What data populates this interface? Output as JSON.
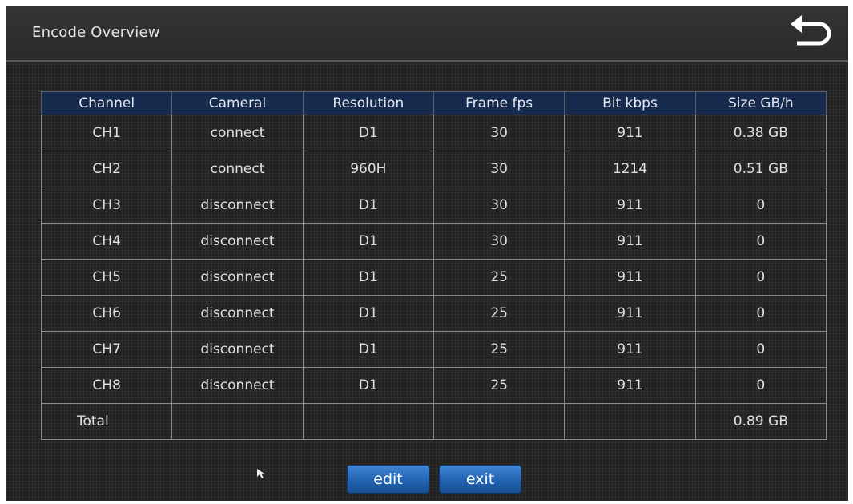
{
  "window": {
    "title": "Encode Overview"
  },
  "header": {
    "back_icon": "return-arrow-icon"
  },
  "table": {
    "columns": [
      "Channel",
      "Cameral",
      "Resolution",
      "Frame fps",
      "Bit kbps",
      "Size GB/h"
    ],
    "rows": [
      [
        "CH1",
        "connect",
        "D1",
        "30",
        "911",
        "0.38 GB"
      ],
      [
        "CH2",
        "connect",
        "960H",
        "30",
        "1214",
        "0.51 GB"
      ],
      [
        "CH3",
        "disconnect",
        "D1",
        "30",
        "911",
        "0"
      ],
      [
        "CH4",
        "disconnect",
        "D1",
        "30",
        "911",
        "0"
      ],
      [
        "CH5",
        "disconnect",
        "D1",
        "25",
        "911",
        "0"
      ],
      [
        "CH6",
        "disconnect",
        "D1",
        "25",
        "911",
        "0"
      ],
      [
        "CH7",
        "disconnect",
        "D1",
        "25",
        "911",
        "0"
      ],
      [
        "CH8",
        "disconnect",
        "D1",
        "25",
        "911",
        "0"
      ]
    ],
    "total": {
      "label": "Total",
      "size": "0.89 GB"
    }
  },
  "buttons": {
    "edit_label": "edit",
    "exit_label": "exit"
  },
  "colors": {
    "header_bg": "#172b4f",
    "button_blue": "#2466b4",
    "background": "#232323"
  }
}
